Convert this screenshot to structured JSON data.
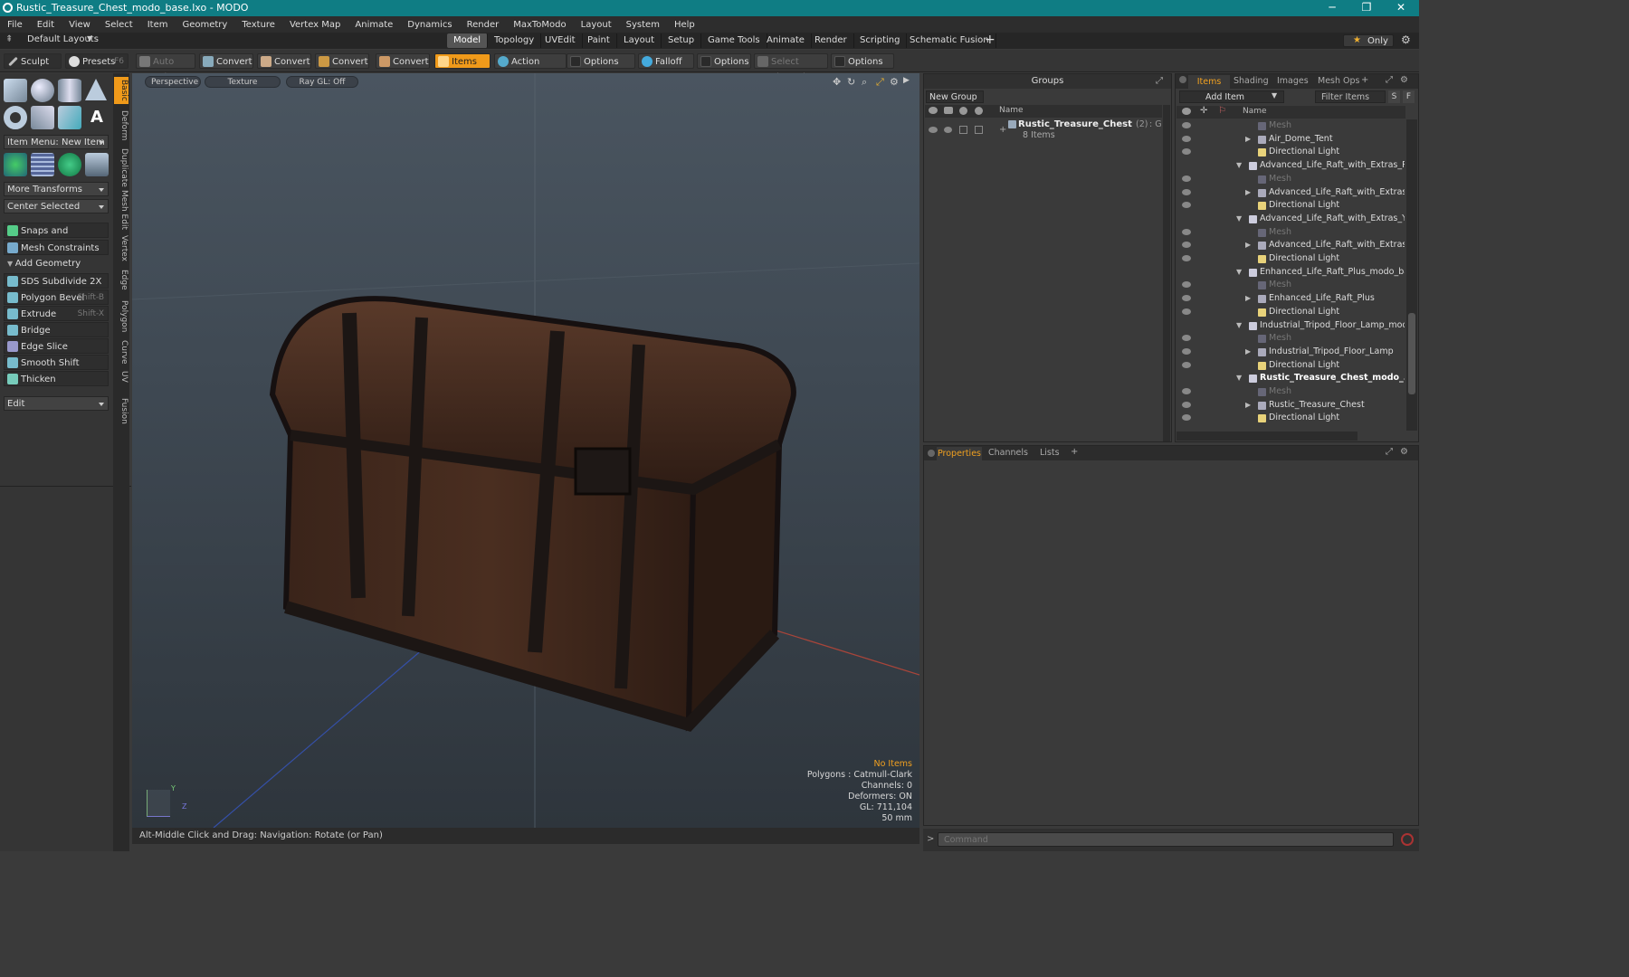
{
  "window": {
    "title": "Rustic_Treasure_Chest_modo_base.lxo - MODO",
    "minimize": "─",
    "maximize": "❐",
    "close": "✕"
  },
  "menu": [
    "File",
    "Edit",
    "View",
    "Select",
    "Item",
    "Geometry",
    "Texture",
    "Vertex Map",
    "Animate",
    "Dynamics",
    "Render",
    "MaxToModo",
    "Layout",
    "System",
    "Help"
  ],
  "layout_bar": {
    "default_layouts": "Default Layouts",
    "tabs": [
      "Model",
      "Topology",
      "UVEdit",
      "Paint",
      "Layout",
      "Setup",
      "Game Tools",
      "Animate",
      "Render",
      "Scripting",
      "Schematic Fusion"
    ],
    "active_tab": "Model",
    "add": "+",
    "only": "Only"
  },
  "toolbar": {
    "sculpt": "Sculpt",
    "presets": "Presets",
    "presets_key": "F6",
    "auto_select": "Auto Select",
    "convert1": "Convert",
    "convert2": "Convert",
    "convert3": "Convert",
    "convert4": "Convert",
    "items": "Items",
    "action_center": "Action Center",
    "options1": "Options",
    "falloff": "Falloff",
    "options2": "Options",
    "select_through": "Select Through",
    "options3": "Options"
  },
  "left_panel": {
    "item_menu": "Item Menu: New Item",
    "more_transforms": "More Transforms",
    "center_selected": "Center Selected",
    "snaps": "Snaps and Precision",
    "mesh_constraints": "Mesh Constraints",
    "add_geometry": "Add Geometry",
    "tools": [
      {
        "label": "SDS Subdivide 2X",
        "shortcut": ""
      },
      {
        "label": "Polygon Bevel",
        "shortcut": "Shift-B"
      },
      {
        "label": "Extrude",
        "shortcut": "Shift-X"
      },
      {
        "label": "Bridge",
        "shortcut": ""
      },
      {
        "label": "Edge Slice",
        "shortcut": ""
      },
      {
        "label": "Smooth Shift",
        "shortcut": ""
      },
      {
        "label": "Thicken",
        "shortcut": ""
      }
    ],
    "edit": "Edit"
  },
  "vertical_tabs": [
    "Basic",
    "Deform",
    "Duplicate",
    "Mesh Edit",
    "Vertex",
    "Edge",
    "Polygon",
    "Curve",
    "UV",
    "Fusion"
  ],
  "viewport": {
    "perspective": "Perspective",
    "texture": "Texture",
    "raygl": "Ray GL: Off",
    "info": {
      "no_items": "No Items",
      "polygons": "Polygons : Catmull-Clark",
      "channels": "Channels: 0",
      "deformers": "Deformers: ON",
      "gl": "GL: 711,104",
      "focal": "50 mm"
    },
    "axis_y": "Y",
    "axis_z": "Z"
  },
  "status_bar": "Alt-Middle Click and Drag:   Navigation: Rotate (or Pan)",
  "groups_panel": {
    "title": "Groups",
    "new_group": "New Group",
    "col_name": "Name",
    "group_name": "Rustic_Treasure_Chest",
    "group_count": "(2)",
    "group_type": ": Group",
    "group_items": "8 Items"
  },
  "items_panel": {
    "tabs": [
      "Items",
      "Shading",
      "Images",
      "Mesh Ops"
    ],
    "add_tab": "+",
    "add_item": "Add Item",
    "filter": "Filter Items",
    "btn_s": "S",
    "btn_f": "F",
    "col_name": "Name",
    "rows": [
      {
        "label": "Mesh",
        "level": 2,
        "kind": "mesh",
        "expand": ""
      },
      {
        "label": "Air_Dome_Tent",
        "level": 2,
        "kind": "item",
        "expand": "▶"
      },
      {
        "label": "Directional Light",
        "level": 2,
        "kind": "light",
        "expand": ""
      },
      {
        "label": "Advanced_Life_Raft_with_Extras_R ...",
        "level": 1,
        "kind": "scene",
        "expand": "▼"
      },
      {
        "label": "Mesh",
        "level": 2,
        "kind": "mesh",
        "expand": ""
      },
      {
        "label": "Advanced_Life_Raft_with_Extras_...",
        "level": 2,
        "kind": "item",
        "expand": "▶"
      },
      {
        "label": "Directional Light",
        "level": 2,
        "kind": "light",
        "expand": ""
      },
      {
        "label": "Advanced_Life_Raft_with_Extras_Ye...",
        "level": 1,
        "kind": "scene",
        "expand": "▼"
      },
      {
        "label": "Mesh",
        "level": 2,
        "kind": "mesh",
        "expand": ""
      },
      {
        "label": "Advanced_Life_Raft_with_Extras_...",
        "level": 2,
        "kind": "item",
        "expand": "▶"
      },
      {
        "label": "Directional Light",
        "level": 2,
        "kind": "light",
        "expand": ""
      },
      {
        "label": "Enhanced_Life_Raft_Plus_modo_bas ...",
        "level": 1,
        "kind": "scene",
        "expand": "▼"
      },
      {
        "label": "Mesh",
        "level": 2,
        "kind": "mesh",
        "expand": ""
      },
      {
        "label": "Enhanced_Life_Raft_Plus",
        "level": 2,
        "kind": "item",
        "expand": "▶"
      },
      {
        "label": "Directional Light",
        "level": 2,
        "kind": "light",
        "expand": ""
      },
      {
        "label": "Industrial_Tripod_Floor_Lamp_modo_...",
        "level": 1,
        "kind": "scene",
        "expand": "▼"
      },
      {
        "label": "Mesh",
        "level": 2,
        "kind": "mesh",
        "expand": ""
      },
      {
        "label": "Industrial_Tripod_Floor_Lamp",
        "level": 2,
        "kind": "item",
        "expand": "▶"
      },
      {
        "label": "Directional Light",
        "level": 2,
        "kind": "light",
        "expand": ""
      },
      {
        "label": "Rustic_Treasure_Chest_modo_...",
        "level": 1,
        "kind": "scene",
        "expand": "▼",
        "bold": true
      },
      {
        "label": "Mesh",
        "level": 2,
        "kind": "mesh",
        "expand": ""
      },
      {
        "label": "Rustic_Treasure_Chest",
        "level": 2,
        "kind": "item",
        "expand": "▶"
      },
      {
        "label": "Directional Light",
        "level": 2,
        "kind": "light",
        "expand": ""
      }
    ]
  },
  "properties_panel": {
    "tabs": [
      "Properties",
      "Channels",
      "Lists"
    ],
    "add_tab": "+"
  },
  "command": {
    "placeholder": "Command",
    "arrow": ">"
  },
  "colors": {
    "accent": "#f09a1a",
    "titlebar": "#0f7d84"
  }
}
